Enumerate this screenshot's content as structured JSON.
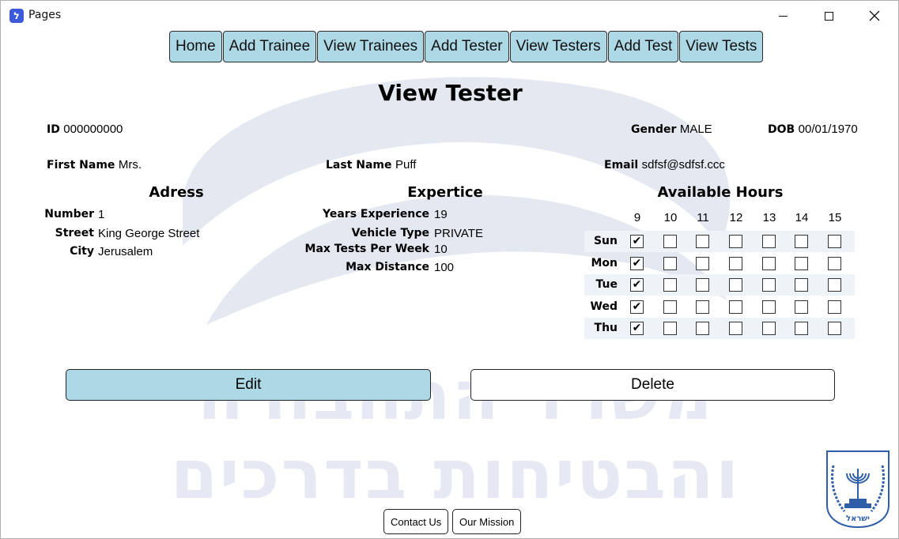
{
  "window": {
    "title": "Pages",
    "icon": "app-logo-icon"
  },
  "watermark": {
    "line1": "משרד התחבורה",
    "line2": "והבטיחות בדרכים"
  },
  "nav": {
    "items": [
      "Home",
      "Add Trainee",
      "View Trainees",
      "Add Tester",
      "View Testers",
      "Add Test",
      "View Tests"
    ]
  },
  "page": {
    "title": "View Tester"
  },
  "tester": {
    "id_label": "ID",
    "id": "000000000",
    "gender_label": "Gender",
    "gender": "MALE",
    "dob_label": "DOB",
    "dob": "00/01/1970",
    "first_name_label": "First Name",
    "first_name": "Mrs.",
    "last_name_label": "Last Name",
    "last_name": "Puff",
    "email_label": "Email",
    "email": "sdfsf@sdfsf.ccc"
  },
  "address": {
    "title": "Adress",
    "number_label": "Number",
    "number": "1",
    "street_label": "Street",
    "street": "King George Street",
    "city_label": "City",
    "city": "Jerusalem"
  },
  "expertise": {
    "title": "Expertice",
    "years_label": "Years Experience",
    "years": "19",
    "vehicle_label": "Vehicle Type",
    "vehicle": "PRIVATE",
    "max_tests_label": "Max Tests Per Week",
    "max_tests": "10",
    "max_distance_label": "Max Distance",
    "max_distance": "100"
  },
  "hours": {
    "title": "Available Hours",
    "columns": [
      "9",
      "10",
      "11",
      "12",
      "13",
      "14",
      "15"
    ],
    "days": [
      {
        "label": "Sun",
        "checked": [
          true,
          false,
          false,
          false,
          false,
          false,
          false
        ]
      },
      {
        "label": "Mon",
        "checked": [
          true,
          false,
          false,
          false,
          false,
          false,
          false
        ]
      },
      {
        "label": "Tue",
        "checked": [
          true,
          false,
          false,
          false,
          false,
          false,
          false
        ]
      },
      {
        "label": "Wed",
        "checked": [
          true,
          false,
          false,
          false,
          false,
          false,
          false
        ]
      },
      {
        "label": "Thu",
        "checked": [
          true,
          false,
          false,
          false,
          false,
          false,
          false
        ]
      }
    ]
  },
  "actions": {
    "edit": "Edit",
    "delete": "Delete"
  },
  "footer": {
    "contact": "Contact Us",
    "mission": "Our Mission",
    "emblem_text": "ישראל"
  },
  "colors": {
    "accent": "#add8e6",
    "row_shade": "#eef3f8",
    "watermark": "#e6e9f3"
  }
}
